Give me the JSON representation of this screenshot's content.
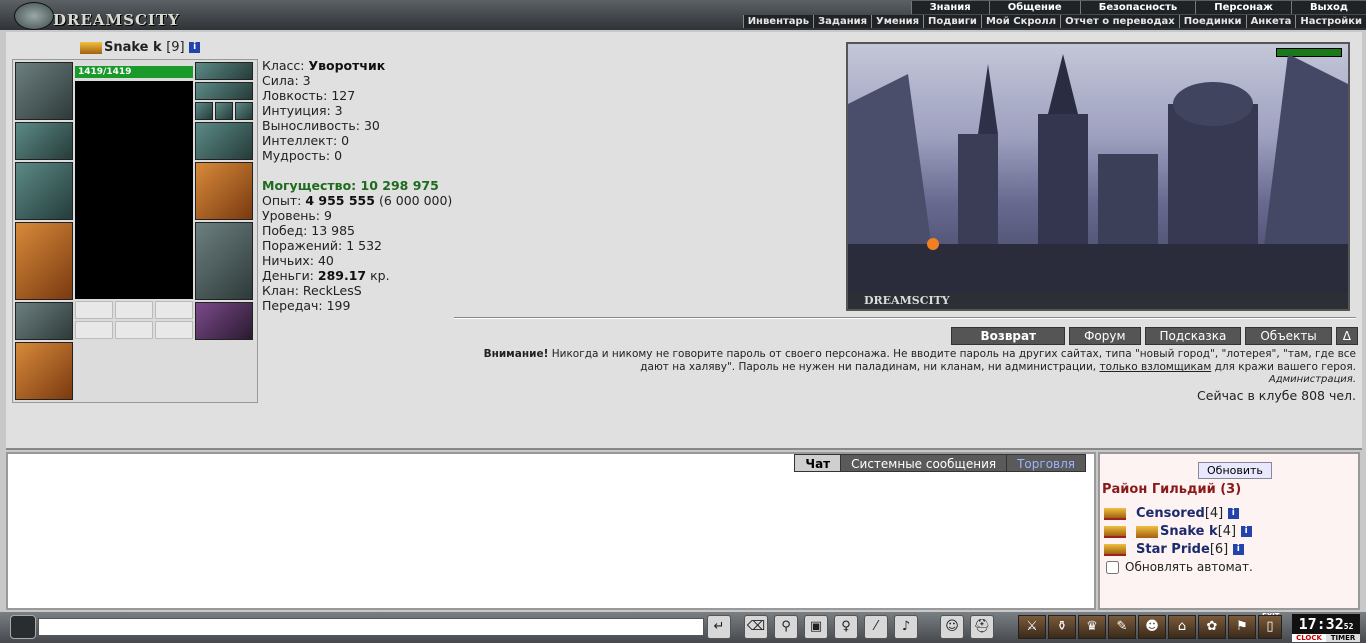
{
  "logo": "DREAMSCITY",
  "menu_top": [
    "Знания",
    "Общение",
    "Безопасность",
    "Персонаж",
    "Выход"
  ],
  "menu_sub": [
    "Инвентарь",
    "Задания",
    "Умения",
    "Подвиги",
    "Мой Скролл",
    "Отчет о переводах",
    "Поединки",
    "Анкета",
    "Настройки"
  ],
  "character": {
    "name": "Snake k",
    "level_tag": "[9]",
    "hp": "1419/1419",
    "class_label": "Класс:",
    "class_value": "Уворотчик",
    "str": "Сила: 3",
    "agi": "Ловкость: 127",
    "int_": "Интуиция: 3",
    "end": "Выносливость: 30",
    "intel": "Интеллект: 0",
    "wis": "Мудрость: 0",
    "power": "Могущество: 10 298 975",
    "exp_label": "Опыт:",
    "exp_value": "4 955 555",
    "exp_next": "(6 000 000)",
    "level": "Уровень: 9",
    "wins": "Побед: 13 985",
    "losses": "Поражений: 1 532",
    "draws": "Ничьих: 40",
    "money_label": "Деньги:",
    "money_value": "289.17",
    "money_unit": "кр.",
    "clan": "Клан: ReckLesS",
    "transfers": "Передач: 199"
  },
  "scene_title": "DREAMSCITY",
  "nav": {
    "return": "Возврат",
    "forum": "Форум",
    "hint": "Подсказка",
    "objects": "Объекты",
    "delta": "Δ"
  },
  "warning": {
    "bold": "Внимание!",
    "text1": "Никогда и никому не говорите пароль от своего персонажа. Не вводите пароль на других сайтах, типа \"новый город\", \"лотерея\", \"там, где все дают на халяву\". Пароль не нужен ни паладинам, ни кланам, ни администрации,",
    "link": "только взломщикам",
    "text2": "для кражи вашего героя.",
    "admin": "Администрация."
  },
  "online": "Сейчас в клубе 808 чел.",
  "chat_tabs": {
    "chat": "Чат",
    "system": "Системные сообщения",
    "trade": "Торговля"
  },
  "side": {
    "refresh": "Обновить",
    "location": "Район Гильдий (3)",
    "users": [
      {
        "name": "Censored",
        "level": "[4]"
      },
      {
        "name": "Snake k",
        "level": "[4]"
      },
      {
        "name": "Star Pride",
        "level": "[6]"
      }
    ],
    "auto": "Обновлять автомат."
  },
  "clock": {
    "time": "17:32",
    "sec": "52",
    "clock_label": "CLOCK",
    "timer_label": "TIMER",
    "exit_label": "EXIT"
  }
}
